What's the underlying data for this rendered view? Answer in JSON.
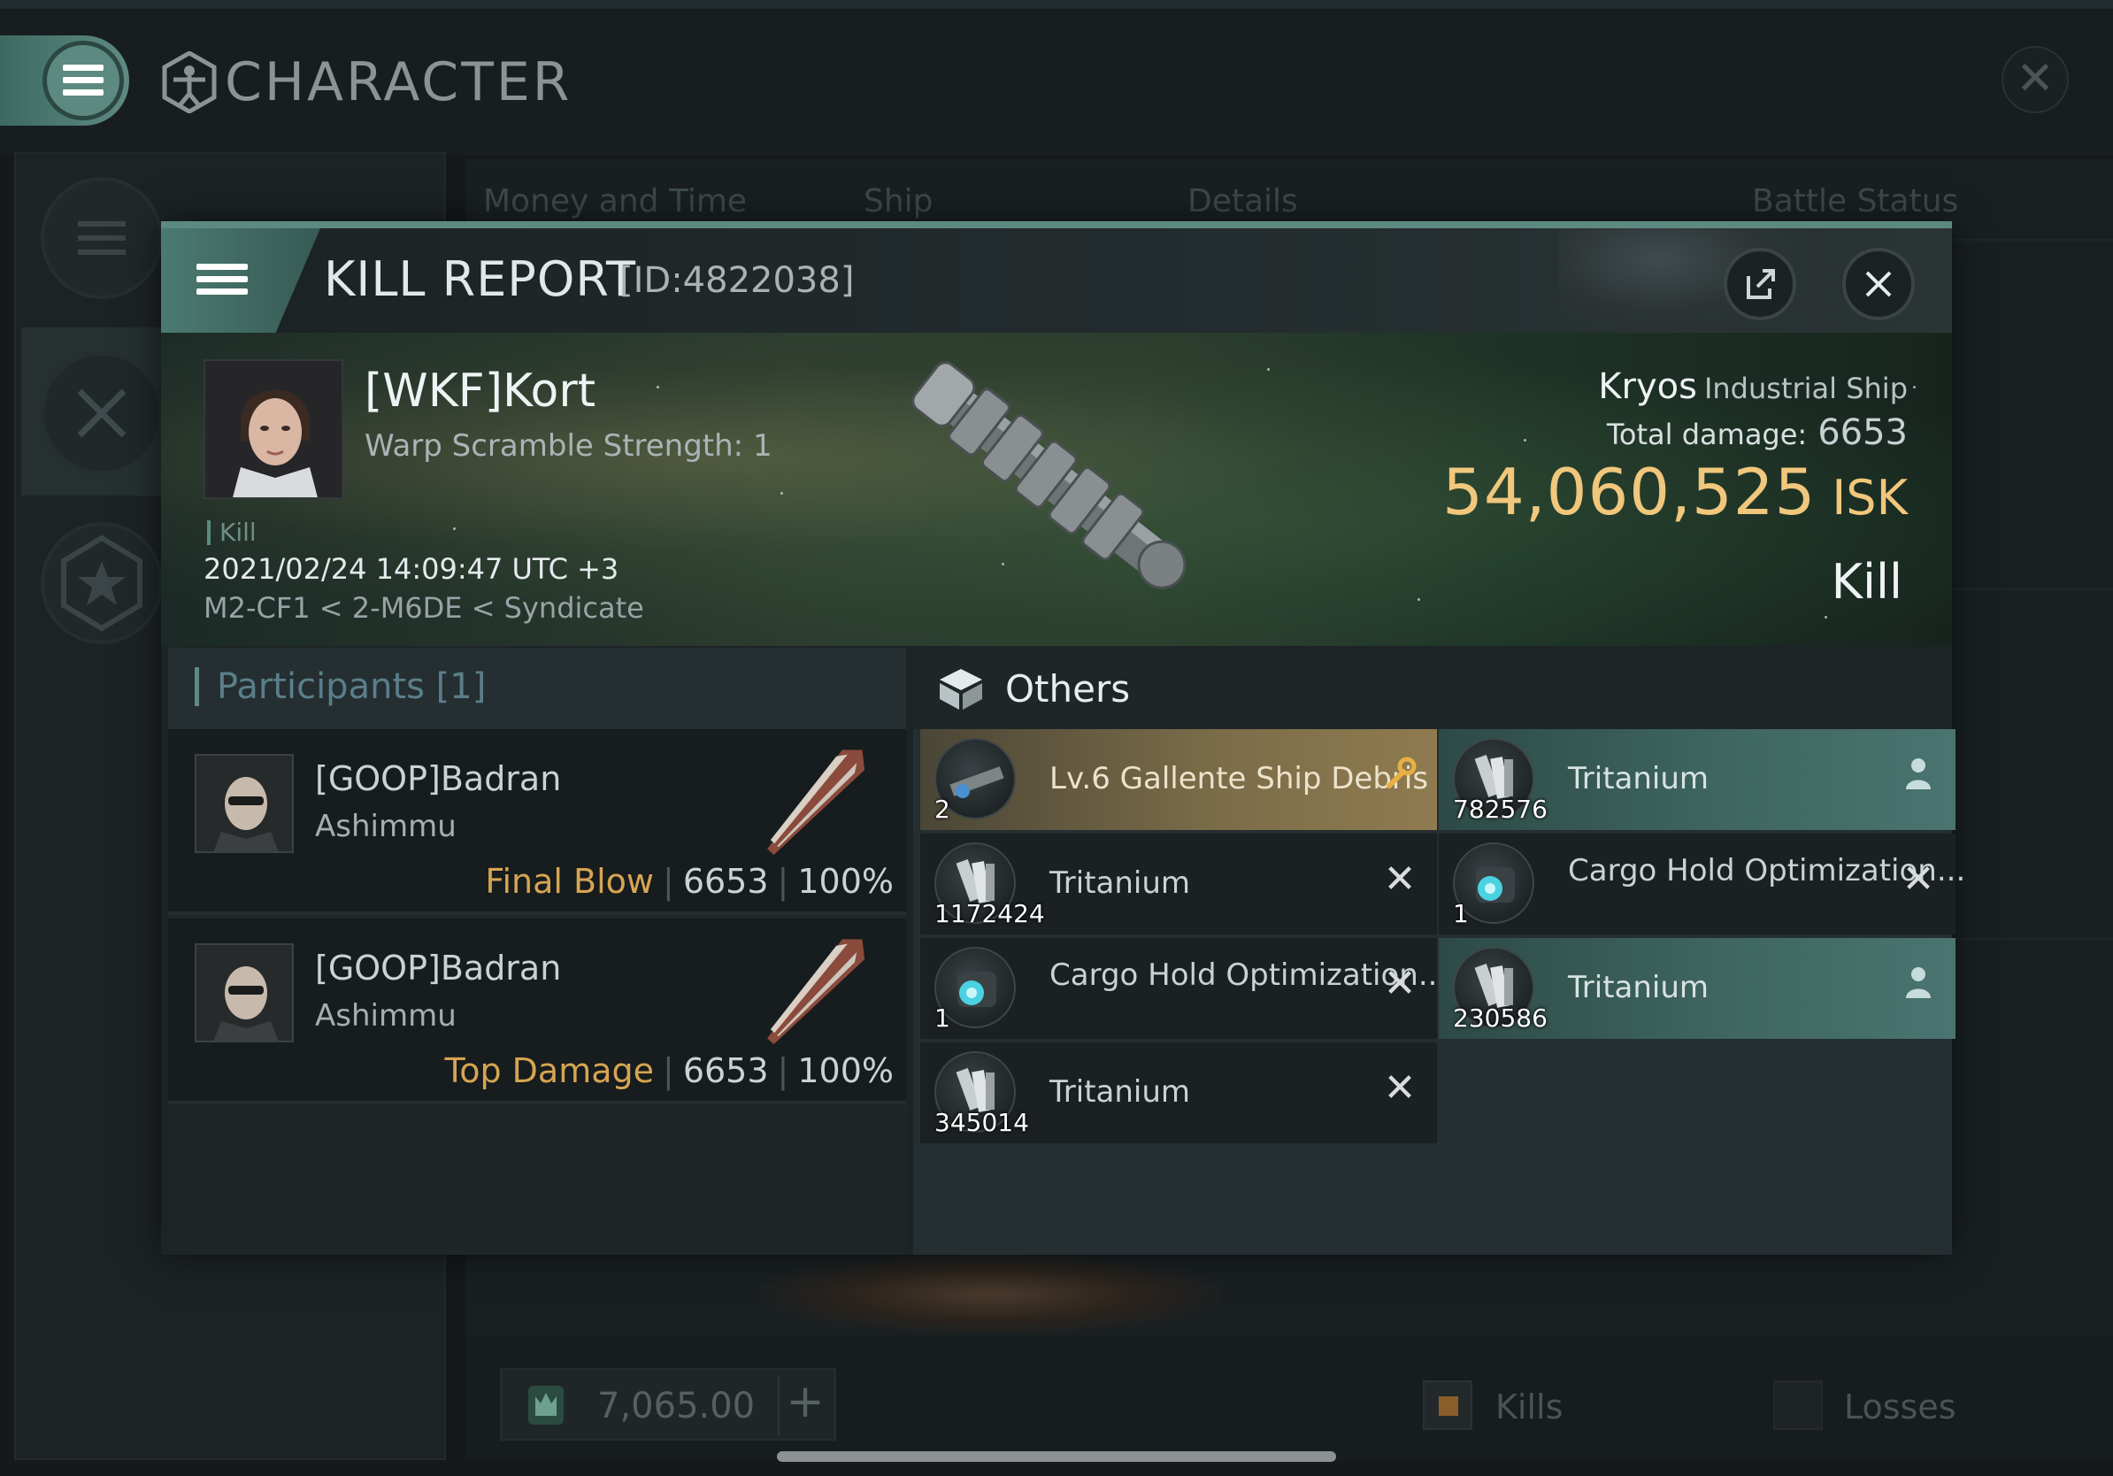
{
  "app": {
    "title": "CHARACTER",
    "icons": {
      "menu": "hamburger-icon",
      "character": "vitruvian-man-icon",
      "close": "close-icon"
    }
  },
  "background": {
    "tabs": [
      "Money and Time",
      "Ship",
      "Details",
      "Battle Status"
    ],
    "balance": "7,065.00",
    "legend": {
      "kills": "Kills",
      "losses": "Losses"
    }
  },
  "dialog": {
    "title": "KILL REPORT",
    "id": "[ID:4822038]",
    "victim": {
      "name": "[WKF]Kort",
      "subtitle": "Warp Scramble Strength: 1",
      "tag": "Kill",
      "datetime": "2021/02/24 14:09:47 UTC +3",
      "location": "M2-CF1 < 2-M6DE < Syndicate"
    },
    "ship": {
      "name": "Kryos",
      "class": "Industrial Ship",
      "damage_label": "Total damage:",
      "damage_value": "6653",
      "isk_value": "54,060,525",
      "isk_unit": "ISK",
      "result": "Kill"
    },
    "participants": {
      "title": "Participants [1]",
      "rows": [
        {
          "name": "[GOOP]Badran",
          "ship": "Ashimmu",
          "role": "Final Blow",
          "damage": "6653",
          "percent": "100%"
        },
        {
          "name": "[GOOP]Badran",
          "ship": "Ashimmu",
          "role": "Top Damage",
          "damage": "6653",
          "percent": "100%"
        }
      ]
    },
    "others": {
      "title": "Others",
      "items": [
        {
          "name": "Lv.6 Gallente Ship Debris",
          "qty": "2",
          "style": "gold",
          "mark": "wrench-icon"
        },
        {
          "name": "Tritanium",
          "qty": "782576",
          "style": "teal",
          "mark": "person-icon"
        },
        {
          "name": "Tritanium",
          "qty": "1172424",
          "style": "dark",
          "mark": "x-icon"
        },
        {
          "name": "Cargo Hold Optimization...",
          "qty": "1",
          "style": "dark",
          "mark": "x-icon"
        },
        {
          "name": "Cargo Hold Optimization...",
          "qty": "1",
          "style": "dark",
          "mark": "x-icon"
        },
        {
          "name": "Tritanium",
          "qty": "230586",
          "style": "teal",
          "mark": "person-icon"
        },
        {
          "name": "Tritanium",
          "qty": "345014",
          "style": "dark",
          "mark": "x-icon"
        }
      ]
    },
    "colors": {
      "accent": "#5d8a80",
      "isk": "#f0c77c",
      "role": "#d6a552",
      "gold_row": "#8f7b4f",
      "teal_row": "#4a7470"
    }
  }
}
